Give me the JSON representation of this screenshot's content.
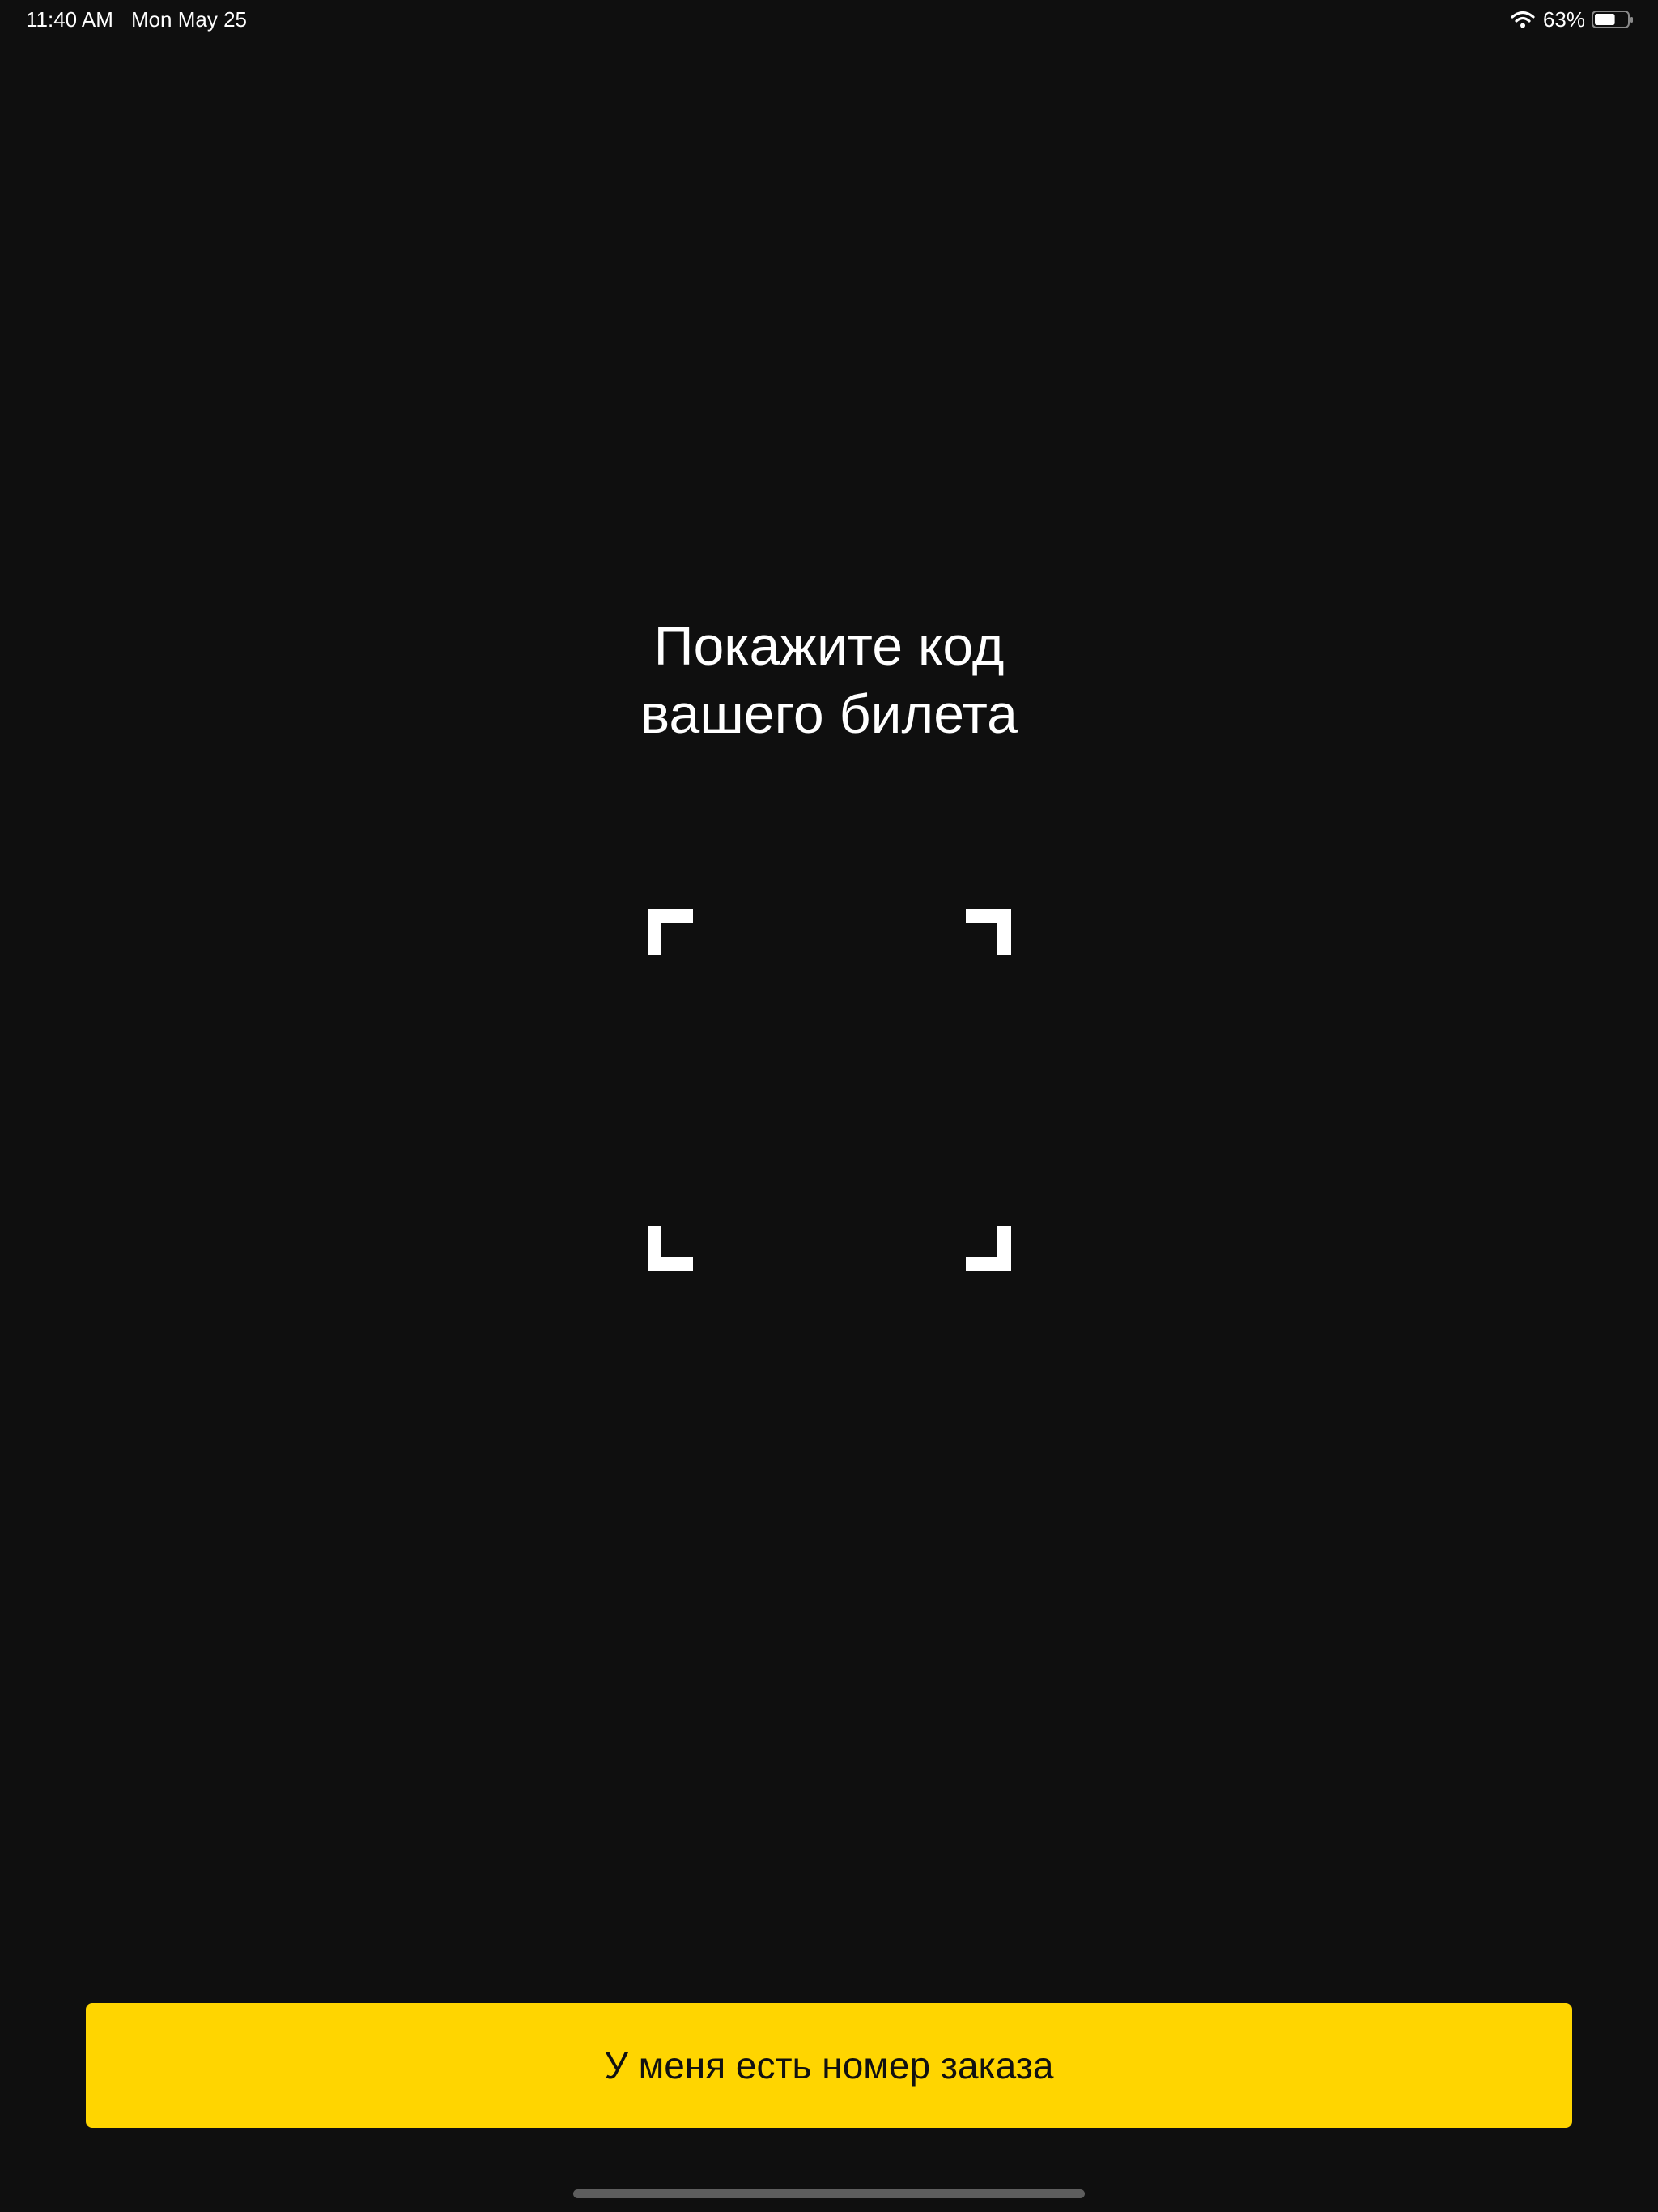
{
  "status_bar": {
    "time": "11:40 AM",
    "date": "Mon May 25",
    "battery_percent": "63%",
    "battery_level": 0.63,
    "icons": [
      "wifi-icon",
      "battery-icon"
    ]
  },
  "prompt": {
    "line1": "Покажите код",
    "line2": "вашего билета"
  },
  "scan_frame": {
    "icon": "scan-frame-icon"
  },
  "order_button": {
    "label": "У меня есть номер заказа"
  },
  "colors": {
    "background": "#0f0f0f",
    "accent": "#ffd500",
    "text": "#ffffff",
    "button_text": "#111111",
    "home_indicator": "#5d5d5d"
  }
}
